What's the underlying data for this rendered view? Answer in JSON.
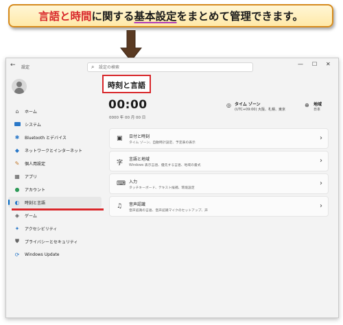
{
  "banner": {
    "part1": "言語と時間",
    "part2": "に関する",
    "part3": "基本設定",
    "part4": "をまとめて管理できます。"
  },
  "window": {
    "app_title": "設定",
    "back_icon": "arrow-left-icon",
    "search_placeholder": "設定の検索",
    "controls": [
      "minimize-icon",
      "maximize-icon",
      "close-icon"
    ]
  },
  "sidebar": {
    "items": [
      {
        "label": "ホーム",
        "icon": "home-icon"
      },
      {
        "label": "システム",
        "icon": "monitor-icon"
      },
      {
        "label": "Bluetooth とデバイス",
        "icon": "bluetooth-icon"
      },
      {
        "label": "ネットワークとインターネット",
        "icon": "wifi-icon"
      },
      {
        "label": "個人用設定",
        "icon": "brush-icon"
      },
      {
        "label": "アプリ",
        "icon": "apps-icon"
      },
      {
        "label": "アカウント",
        "icon": "person-icon"
      },
      {
        "label": "時刻と言語",
        "icon": "globe-clock-icon",
        "active": true
      },
      {
        "label": "ゲーム",
        "icon": "gamepad-icon"
      },
      {
        "label": "アクセシビリティ",
        "icon": "accessibility-icon"
      },
      {
        "label": "プライバシーとセキュリティ",
        "icon": "shield-icon"
      },
      {
        "label": "Windows Update",
        "icon": "update-icon"
      }
    ]
  },
  "main": {
    "page_title": "時刻と言語",
    "clock": "00:00",
    "date": "0000 年 00 月 00 日",
    "timezone": {
      "label": "タイム ゾーン",
      "value": "(UTC+09:00) 大阪、札幌、東京"
    },
    "region": {
      "label": "地域",
      "value": "日本"
    },
    "cards": [
      {
        "title": "日付と時刻",
        "subtitle": "タイム ゾーン、自動時計設定、予定表の表示",
        "icon": "calendar-clock-icon"
      },
      {
        "title": "言語と地域",
        "subtitle": "Windows 表示言語、優先する言語、地域の書式",
        "icon": "language-icon"
      },
      {
        "title": "入力",
        "subtitle": "タッチキーボード、テキスト候補、環境設定",
        "icon": "keyboard-icon"
      },
      {
        "title": "音声認識",
        "subtitle": "音声認識の言語、音声認識マイクのセットアップ、声",
        "icon": "microphone-icon"
      }
    ]
  },
  "colors": {
    "accent_red": "#d8262a",
    "banner_border": "#d68a1c",
    "arrow": "#5a3a22",
    "nav_indicator": "#0067c0"
  }
}
